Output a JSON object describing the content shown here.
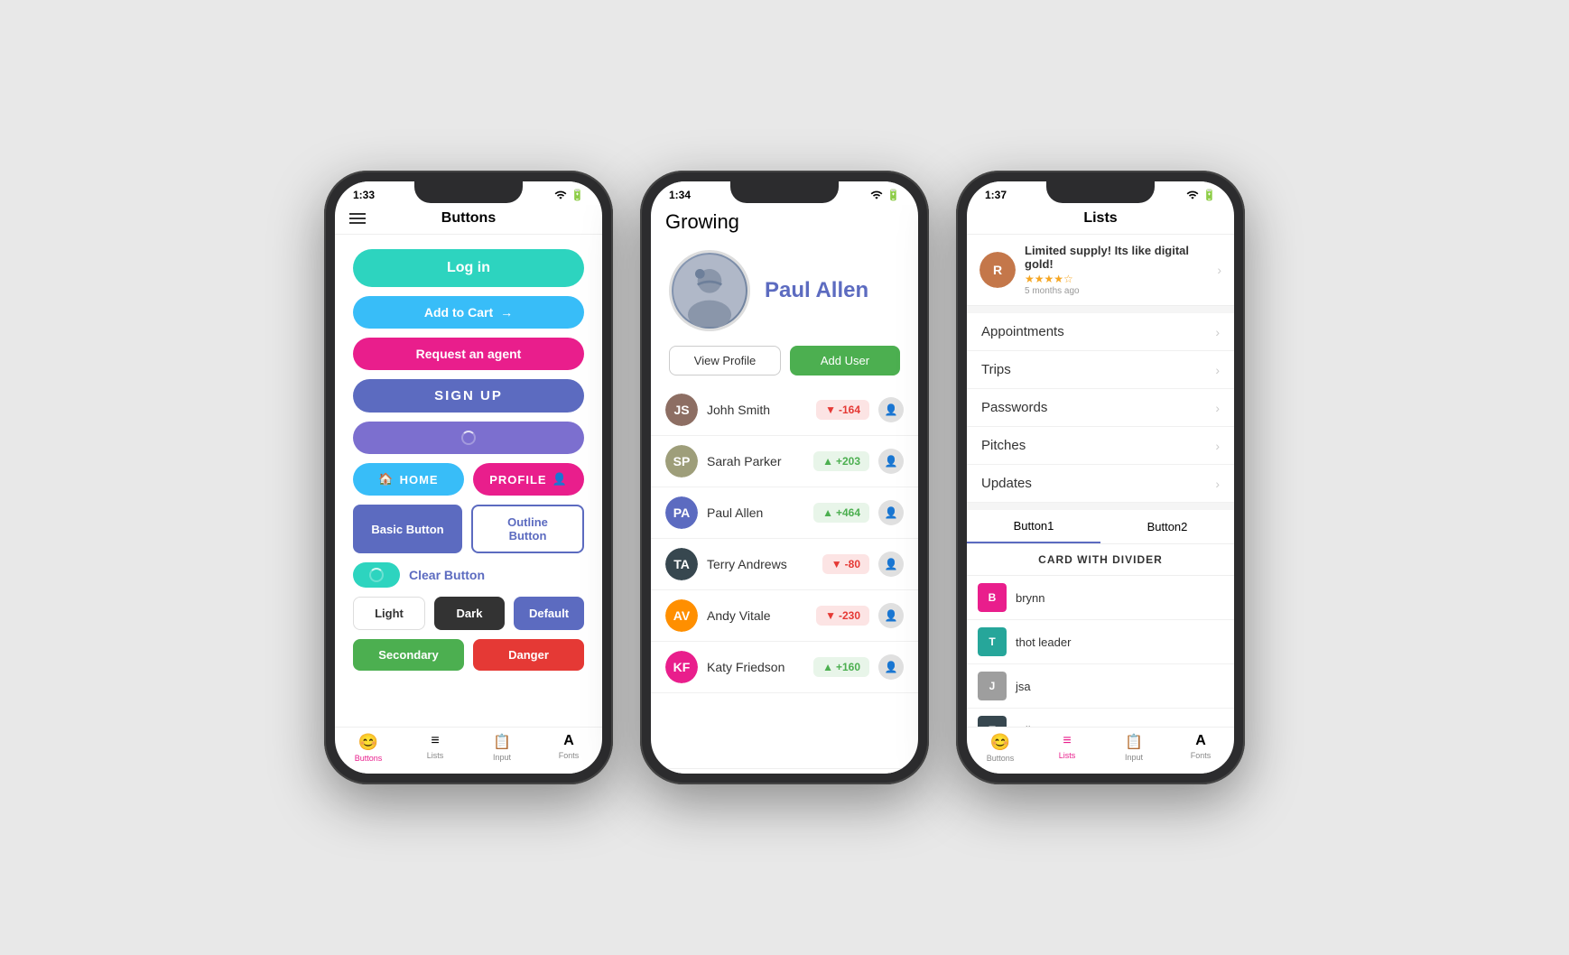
{
  "phone1": {
    "time": "1:33",
    "title": "Buttons",
    "buttons": {
      "login": "Log in",
      "addcart": "Add to Cart",
      "agent": "Request an agent",
      "signup": "SIGN UP",
      "home": "HOME",
      "profile": "PROFILE",
      "basic": "Basic Button",
      "outline": "Outline Button",
      "clear": "Clear Button",
      "light": "Light",
      "dark": "Dark",
      "default": "Default",
      "secondary": "Secondary",
      "danger": "Danger"
    },
    "tabs": [
      {
        "label": "Buttons",
        "icon": "😊",
        "active": true
      },
      {
        "label": "Lists",
        "icon": "≡",
        "active": false
      },
      {
        "label": "Input",
        "icon": "📋",
        "active": false
      },
      {
        "label": "Fonts",
        "icon": "A",
        "active": false
      }
    ]
  },
  "phone2": {
    "time": "1:34",
    "app_title": "Growing",
    "user": {
      "name": "Paul Allen",
      "view_profile": "View Profile",
      "add_user": "Add User"
    },
    "users": [
      {
        "name": "Johh Smith",
        "score": "-164",
        "positive": false,
        "color": "av-brown",
        "initials": "JS"
      },
      {
        "name": "Sarah Parker",
        "score": "+203",
        "positive": true,
        "color": "av-olive",
        "initials": "SP"
      },
      {
        "name": "Paul Allen",
        "score": "+464",
        "positive": true,
        "color": "av-blue",
        "initials": "PA"
      },
      {
        "name": "Terry Andrews",
        "score": "-80",
        "positive": false,
        "color": "av-dark",
        "initials": "TA"
      },
      {
        "name": "Andy Vitale",
        "score": "-230",
        "positive": false,
        "color": "av-orange",
        "initials": "AV"
      },
      {
        "name": "Katy Friedson",
        "score": "+160",
        "positive": true,
        "color": "av-pink",
        "initials": "KF"
      }
    ]
  },
  "phone3": {
    "time": "1:37",
    "title": "Lists",
    "review": {
      "text": "Limited supply! Its like digital gold!",
      "stars": "★★★★☆",
      "time": "5 months ago"
    },
    "list_items": [
      "Appointments",
      "Trips",
      "Passwords",
      "Pitches",
      "Updates"
    ],
    "tabs": [
      {
        "label": "Button1",
        "active": true
      },
      {
        "label": "Button2",
        "active": false
      }
    ],
    "card": {
      "header": "CARD WITH DIVIDER",
      "items": [
        {
          "name": "brynn",
          "color": "av-pink"
        },
        {
          "name": "thot leader",
          "color": "av-teal"
        },
        {
          "name": "jsa",
          "color": "av-gray"
        },
        {
          "name": "talhaconcepts",
          "color": "av-dark"
        }
      ]
    },
    "bottom_tabs": [
      {
        "label": "Buttons",
        "icon": "😊",
        "active": false
      },
      {
        "label": "Lists",
        "icon": "≡",
        "active": true
      },
      {
        "label": "Input",
        "icon": "📋",
        "active": false
      },
      {
        "label": "Fonts",
        "icon": "A",
        "active": false
      }
    ]
  }
}
